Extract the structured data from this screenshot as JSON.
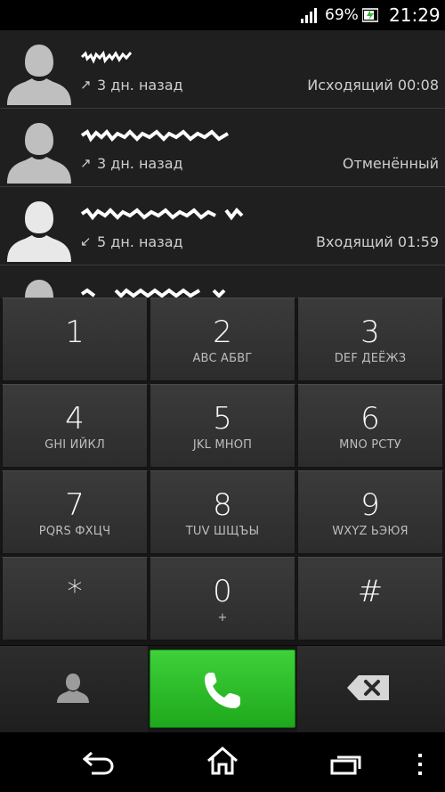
{
  "status_bar": {
    "battery_percent": "69%",
    "time": "21:29"
  },
  "call_log": [
    {
      "direction_arrow": "↗",
      "ago": "3 дн. назад",
      "status": "Исходящий 00:08"
    },
    {
      "direction_arrow": "↗",
      "ago": "3 дн. назад",
      "status": "Отменённый"
    },
    {
      "direction_arrow": "↙",
      "ago": "5 дн. назад",
      "status": "Входящий 01:59"
    }
  ],
  "dialpad": {
    "keys": [
      {
        "digit": "1",
        "letters": ""
      },
      {
        "digit": "2",
        "letters": "ABC АБВГ"
      },
      {
        "digit": "3",
        "letters": "DEF ДЕЁЖЗ"
      },
      {
        "digit": "4",
        "letters": "GHI ИЙКЛ"
      },
      {
        "digit": "5",
        "letters": "JKL МНОП"
      },
      {
        "digit": "6",
        "letters": "MNO РСТУ"
      },
      {
        "digit": "7",
        "letters": "PQRS ФХЦЧ"
      },
      {
        "digit": "8",
        "letters": "TUV ШЩЪЫ"
      },
      {
        "digit": "9",
        "letters": "WXYZ ЬЭЮЯ"
      },
      {
        "digit": "*",
        "letters": ""
      },
      {
        "digit": "0",
        "letters": "+"
      },
      {
        "digit": "#",
        "letters": ""
      }
    ]
  },
  "icons": {
    "contacts": "contact-person-icon",
    "call": "phone-handset-icon",
    "backspace": "backspace-icon",
    "nav_back": "back-icon",
    "nav_home": "home-icon",
    "nav_recents": "recent-apps-icon",
    "nav_menu": "overflow-menu-icon"
  },
  "colors": {
    "call_button": "#22b21f",
    "background": "#1e1e1e"
  }
}
